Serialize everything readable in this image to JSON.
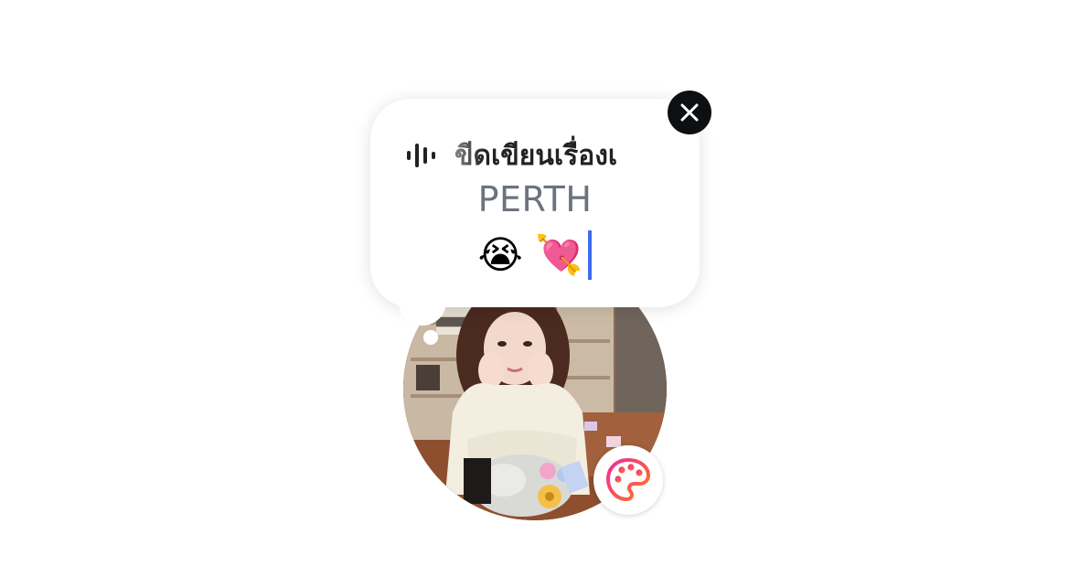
{
  "note": {
    "music_icon": "audio-wave-icon",
    "song_title": "ขีดเขียนเรื่องเ",
    "artist": "PERTH",
    "text": "😭 💘"
  },
  "controls": {
    "close_icon": "close-icon",
    "palette_icon": "palette-icon"
  },
  "colors": {
    "caret": "#3d6cf0",
    "artist_text": "#6b7380",
    "close_bg": "#0d0f12",
    "palette_gradient_start": "#f02a9c",
    "palette_gradient_end": "#ff7a1a"
  }
}
